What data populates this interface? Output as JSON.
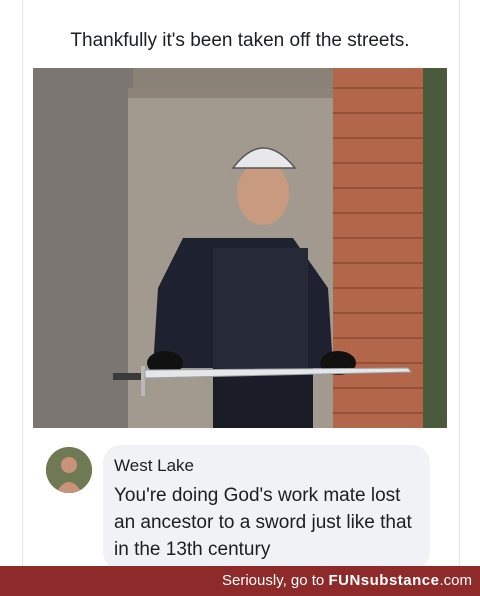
{
  "post": {
    "caption": "Thankfully it's been taken off the streets.",
    "photo_icon": "police-officer-holding-sword-photo"
  },
  "comment": {
    "author": "West Lake",
    "text": "You're doing God's work mate lost an ancestor to a sword just like that in the 13th century",
    "avatar_icon": "user-avatar"
  },
  "footer": {
    "prefix": "Seriously, go to ",
    "brand": "FUNsubstance",
    "suffix": ".com",
    "background_color": "#8e2a2a"
  }
}
